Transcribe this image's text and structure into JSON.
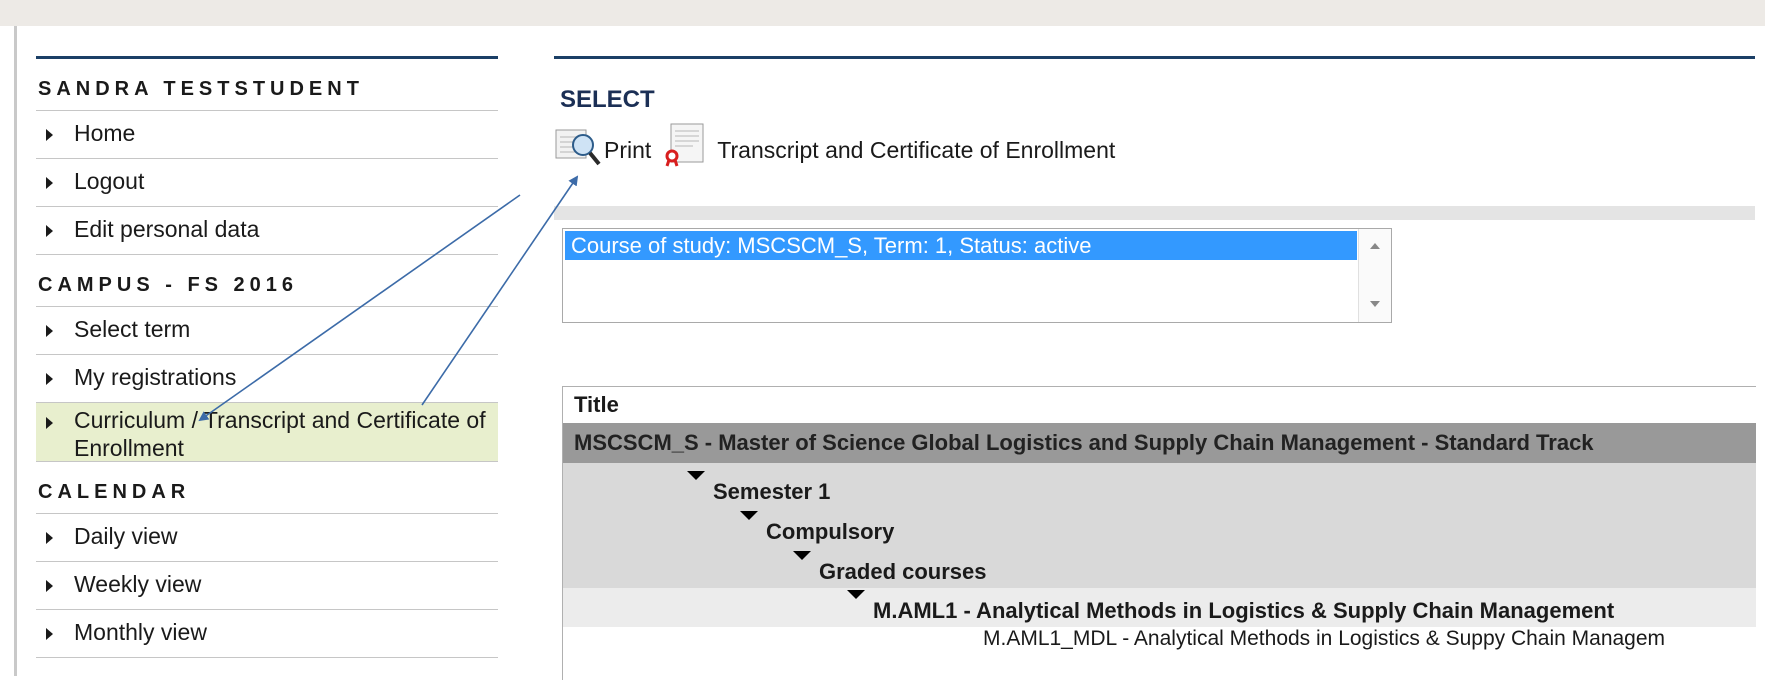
{
  "sidebar": {
    "user_name": "SANDRA TESTSTUDENT",
    "user_items": [
      "Home",
      "Logout",
      "Edit personal data"
    ],
    "campus_heading": "CAMPUS - FS 2016",
    "campus_items": [
      "Select term",
      "My registrations",
      "Curriculum / Transcript and Certificate of Enrollment"
    ],
    "calendar_heading": "CALENDAR",
    "calendar_items": [
      "Daily view",
      "Weekly view",
      "Monthly view"
    ],
    "active_item": "Curriculum / Transcript and Certificate of Enrollment"
  },
  "main": {
    "title": "SELECT",
    "print_label": "Print",
    "transcript_link": "Transcript and Certificate of Enrollment",
    "listbox_selected": "Course of study: MSCSCM_S, Term: 1, Status: active",
    "table_header": "Title",
    "program_row": "MSCSCM_S - Master of Science Global Logistics and Supply Chain Management - Standard Track",
    "semester": "Semester 1",
    "compulsory": "Compulsory",
    "graded": "Graded courses",
    "course": "M.AML1 - Analytical Methods in Logistics & Supply Chain Management",
    "module": "M.AML1_MDL - Analytical Methods in Logistics & Suppy Chain Managem"
  },
  "colors": {
    "accent_border": "#1b3f66",
    "active_nav_bg": "#e8efce",
    "selection_bg": "#3399ff",
    "program_row_bg": "#999999",
    "annotation_arrow": "#3c6ba8"
  }
}
